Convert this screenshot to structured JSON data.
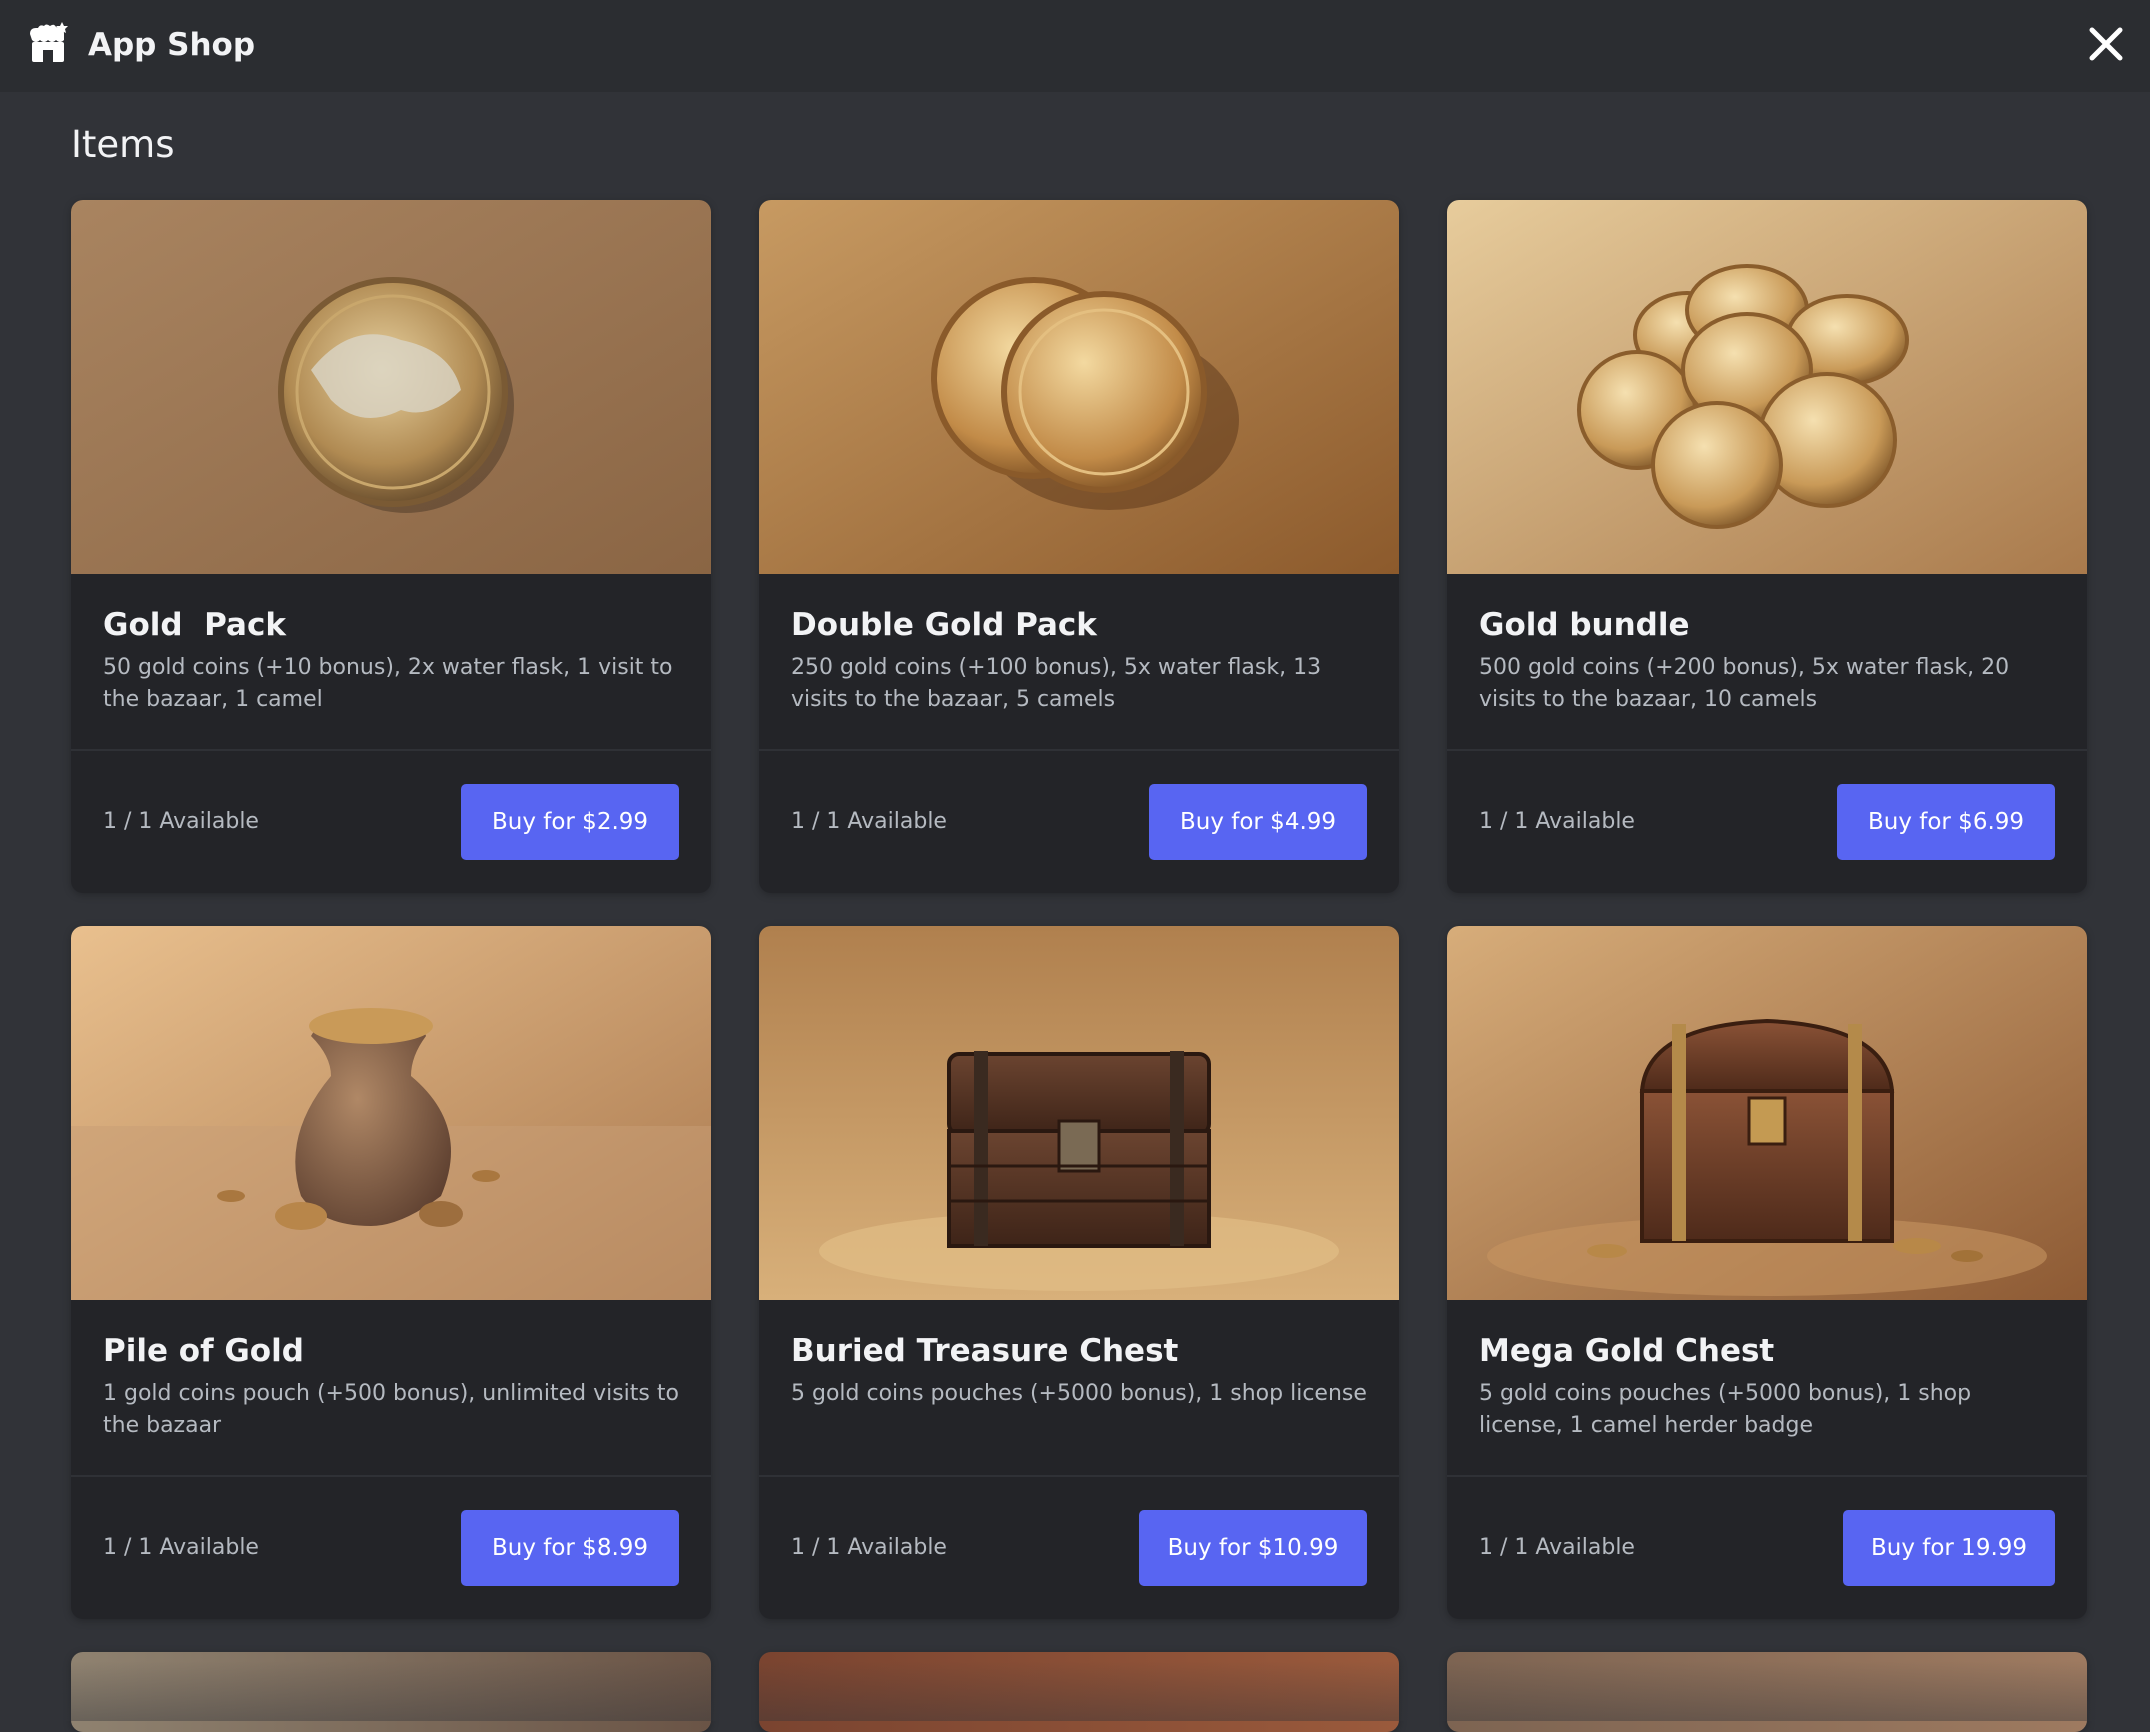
{
  "window": {
    "title": "App Shop",
    "app_icon": "shop-icon",
    "close_icon": "close-icon"
  },
  "section": {
    "title": "Items"
  },
  "items": [
    {
      "title": "Gold  Pack",
      "description": "50 gold coins (+10 bonus), 2x water flask, 1 visit to the bazaar, 1 camel",
      "availability": "1 / 1 Available",
      "buy_label": "Buy for $2.99",
      "image": "single-gold-coin"
    },
    {
      "title": "Double Gold Pack",
      "description": "250 gold coins (+100 bonus), 5x water flask, 13 visits to the bazaar, 5 camels",
      "availability": "1 / 1 Available",
      "buy_label": "Buy for $4.99",
      "image": "two-gold-coins"
    },
    {
      "title": "Gold bundle",
      "description": "500 gold coins (+200 bonus), 5x water flask, 20 visits to the bazaar, 10 camels",
      "availability": "1 / 1 Available",
      "buy_label": "Buy for $6.99",
      "image": "pile-of-gold-coins"
    },
    {
      "title": "Pile of Gold",
      "description": "1 gold coins pouch (+500 bonus), unlimited visits to the bazaar",
      "availability": "1 / 1 Available",
      "buy_label": "Buy for $8.99",
      "image": "coin-pouch"
    },
    {
      "title": "Buried Treasure Chest",
      "description": "5 gold coins pouches (+5000 bonus),  1 shop license",
      "availability": "1 / 1 Available",
      "buy_label": "Buy for $10.99",
      "image": "treasure-chest"
    },
    {
      "title": "Mega Gold Chest",
      "description": "5 gold coins pouches (+5000 bonus),  1 shop license, 1 camel herder badge",
      "availability": "1 / 1 Available",
      "buy_label": "Buy for 19.99",
      "image": "open-treasure-chest"
    }
  ],
  "colors": {
    "background": "#313338",
    "topbar": "#2b2d31",
    "card": "#232428",
    "button": "#5865f2",
    "text_primary": "#f2f3f5",
    "text_secondary": "#b5bac1"
  }
}
